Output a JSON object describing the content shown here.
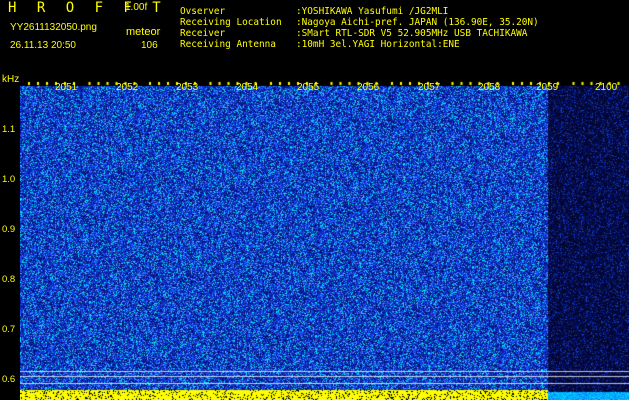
{
  "header": {
    "brand": "H R O F F T",
    "version": "1.00f",
    "filename": "YY2611132050.png",
    "mode": "meteor",
    "datetime": "26.11.13 20:50",
    "count": "106",
    "meta": [
      {
        "key": "Ovserver",
        "value": ":YOSHIKAWA Yasufumi /JG2MLI"
      },
      {
        "key": "Receiving Location",
        "value": ":Nagoya Aichi-pref. JAPAN (136.90E, 35.20N)"
      },
      {
        "key": "Receiver",
        "value": ":SMart RTL-SDR V5 52.905MHz USB TACHIKAWA"
      },
      {
        "key": "Receiving Antenna",
        "value": ":10mH 3el.YAGI Horizontal:ENE"
      }
    ]
  },
  "axis": {
    "y_unit": "kHz",
    "y_ticks": [
      "1.1",
      "1.0",
      "0.9",
      "0.8",
      "0.7",
      "0.6"
    ],
    "x_ticks": [
      "2051",
      "2052",
      "2053",
      "2054",
      "2055",
      "2056",
      "2057",
      "2058",
      "2059",
      "2100"
    ]
  },
  "colors": {
    "text": "#ffff00",
    "background": "#000000",
    "noise_low": "#0a1a8c",
    "noise_mid": "#1e50ff",
    "noise_high": "#00e6ff",
    "marker_line": "#ffffff"
  }
}
